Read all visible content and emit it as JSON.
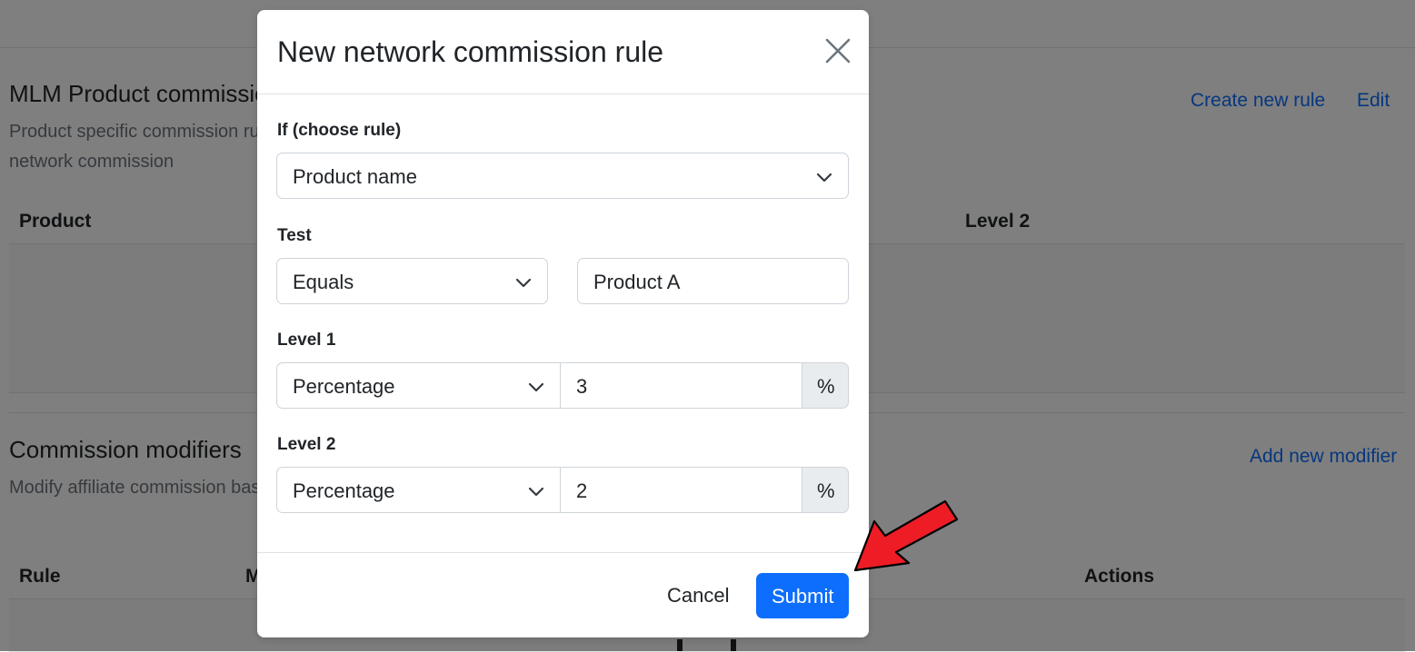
{
  "background": {
    "product_section": {
      "title": "MLM Product commissions",
      "description": "Product specific commission rules to override the default network commission",
      "actions": {
        "create": "Create new rule",
        "edit": "Edit"
      },
      "columns": [
        "Product",
        "Level 2"
      ]
    },
    "modifiers_section": {
      "title": "Commission modifiers",
      "description": "Modify affiliate commission based on specific users only",
      "actions": {
        "add": "Add new modifier"
      },
      "columns": [
        "Rule",
        "M",
        "Actions"
      ]
    }
  },
  "modal": {
    "title": "New network commission rule",
    "close_icon": "close-icon",
    "rule": {
      "label": "If (choose rule)",
      "value": "Product name"
    },
    "test": {
      "label": "Test",
      "operator": "Equals",
      "value": "Product A"
    },
    "level1": {
      "label": "Level 1",
      "type": "Percentage",
      "value": "3",
      "unit": "%"
    },
    "level2": {
      "label": "Level 2",
      "type": "Percentage",
      "value": "2",
      "unit": "%"
    },
    "footer": {
      "cancel": "Cancel",
      "submit": "Submit"
    }
  },
  "colors": {
    "primary": "#0d6efd",
    "arrow": "#ee1c25",
    "backdrop": "rgba(0,0,0,0.5)"
  }
}
